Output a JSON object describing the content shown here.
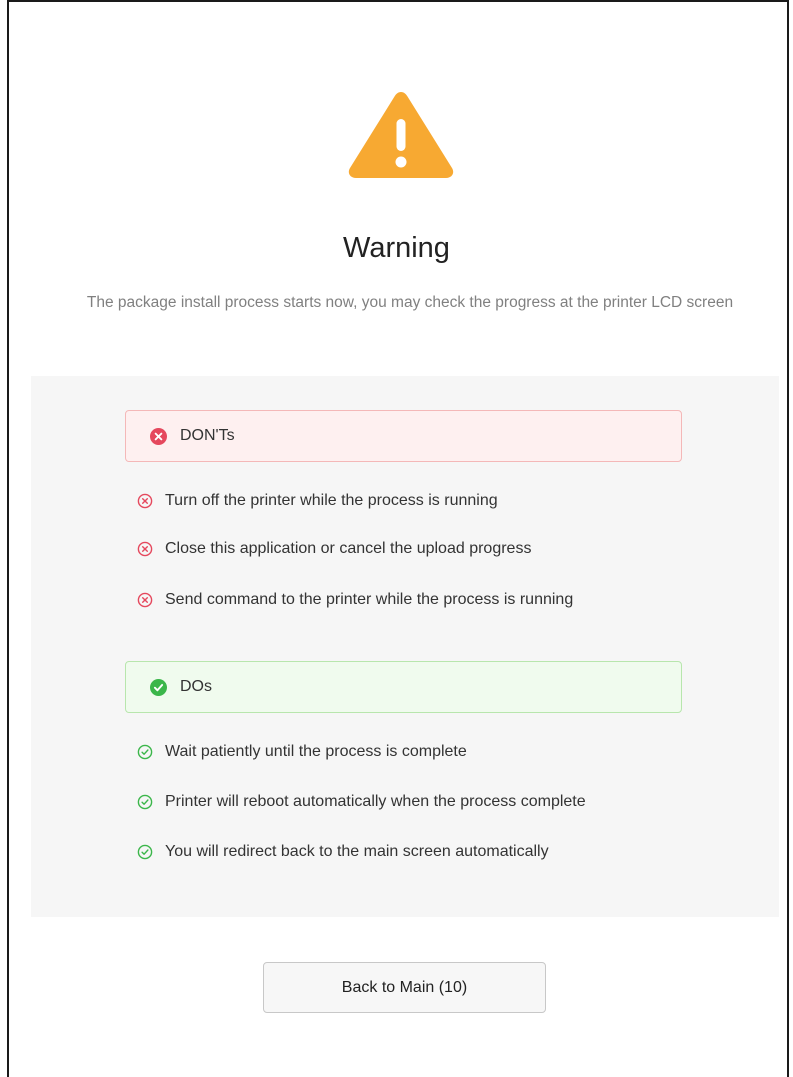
{
  "dialog": {
    "icon": "warning-triangle-icon",
    "title": "Warning",
    "message": "The package install process starts now, you may check the progress at the printer LCD screen"
  },
  "donts": {
    "heading": "DON'Ts",
    "icon": "error-filled-icon",
    "color": "#e5485d",
    "items": [
      "Turn off the printer while the process is running",
      "Close this application or cancel the upload progress",
      "Send command to the printer while the process is running"
    ]
  },
  "dos": {
    "heading": "DOs",
    "icon": "success-filled-icon",
    "color": "#3bb64a",
    "items": [
      "Wait patiently until the process is complete",
      "Printer will reboot automatically when the process complete",
      "You will redirect back to the main screen automatically"
    ]
  },
  "actions": {
    "back_label": "Back to Main (10)"
  },
  "colors": {
    "warning": "#f7a932",
    "panel_bg": "#f6f6f6"
  }
}
